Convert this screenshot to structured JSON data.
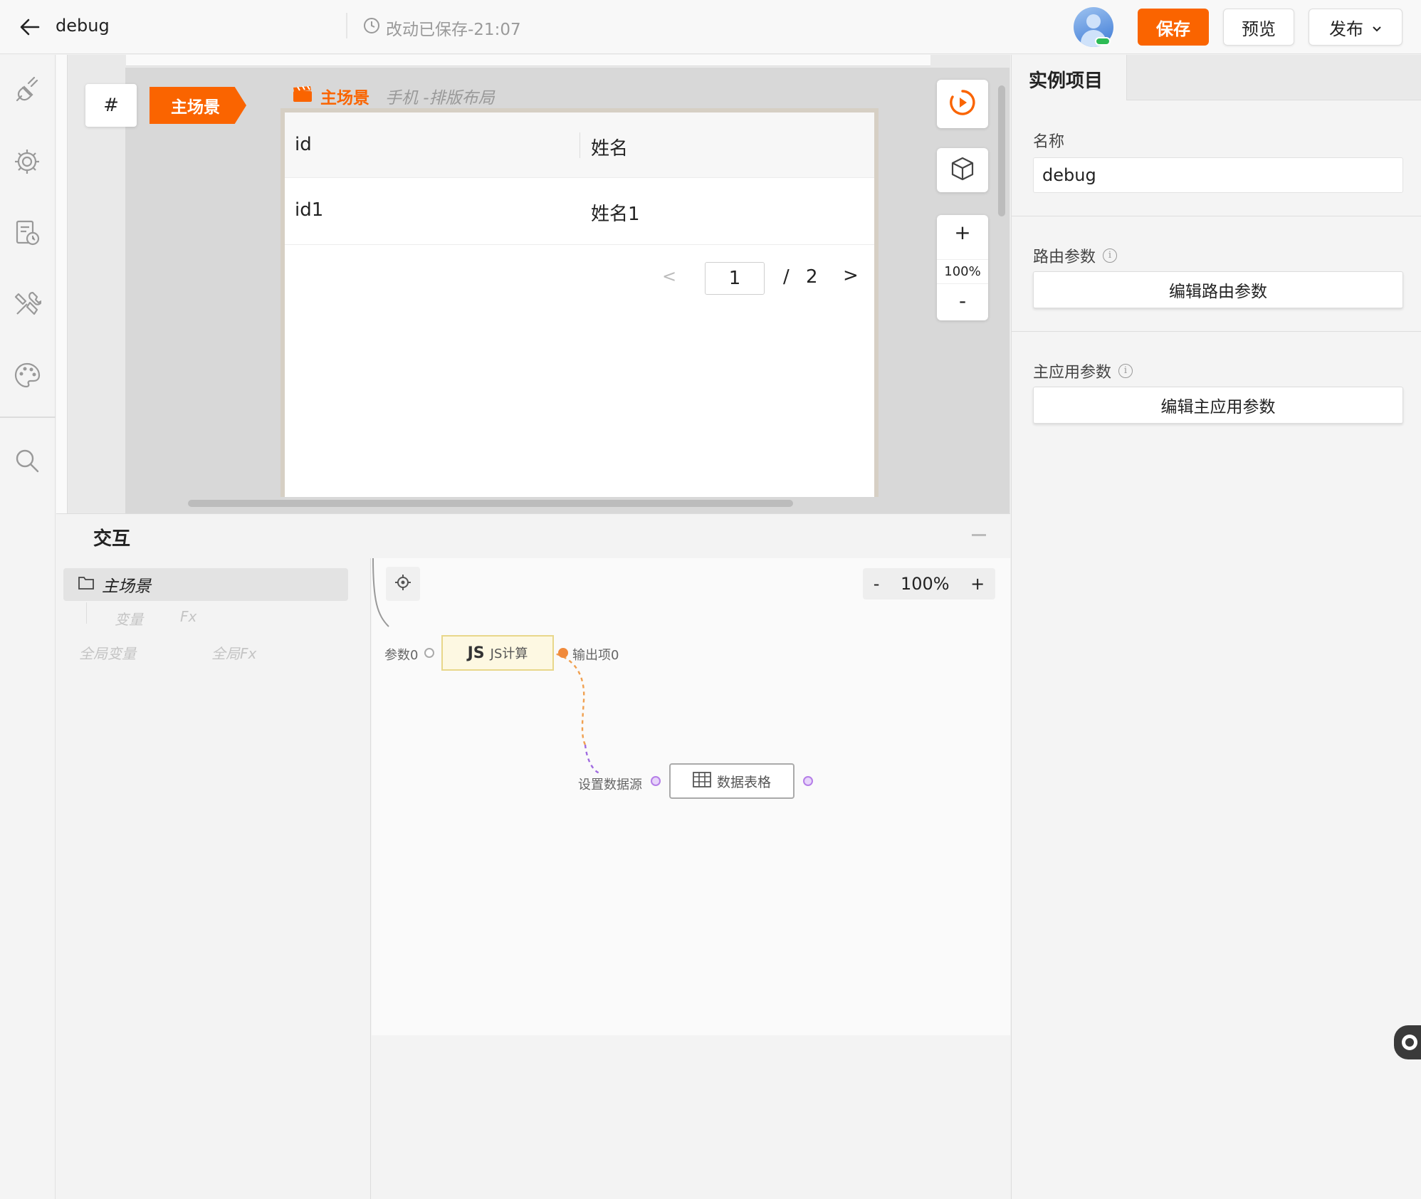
{
  "header": {
    "project_name": "debug",
    "save_status": "改动已保存-21:07",
    "save_label": "保存",
    "preview_label": "预览",
    "publish_label": "发布"
  },
  "rail": {
    "icons": [
      "plugin-icon",
      "settings-icon",
      "history-icon",
      "tools-icon",
      "palette-icon",
      "search-icon"
    ]
  },
  "canvas": {
    "hash_label": "#",
    "scene_tag": "主场景",
    "page_scene": "主场景",
    "page_layout": "手机 -排版布局",
    "table": {
      "columns": [
        "id",
        "姓名"
      ],
      "rows": [
        [
          "id1",
          "姓名1"
        ]
      ]
    },
    "pager": {
      "current": "1",
      "slash": "/",
      "total": "2",
      "prev": "<",
      "next": ">"
    },
    "zoom": {
      "plus": "+",
      "value": "100%",
      "minus": "-"
    }
  },
  "interaction": {
    "title": "交互",
    "tree": {
      "scene": "主场景",
      "var": "变量",
      "fx": "Fx",
      "global_var": "全局变量",
      "global_fx": "全局Fx"
    },
    "graph_zoom": {
      "minus": "-",
      "value": "100%",
      "plus": "+"
    },
    "nodes": {
      "js_logo": "JS",
      "js_label": "JS计算",
      "js_input": "参数0",
      "js_output": "输出项0",
      "table_label": "数据表格",
      "table_input": "设置数据源"
    },
    "colors": {
      "output_port": "#f08a3c",
      "purple_port": "#b57ee8",
      "orange_wire": "#f0a050",
      "purple_wire": "#a06be0"
    }
  },
  "props": {
    "tab": "实例项目",
    "name_label": "名称",
    "name_value": "debug",
    "route_label": "路由参数",
    "route_button": "编辑路由参数",
    "app_label": "主应用参数",
    "app_button": "编辑主应用参数",
    "info": "i"
  },
  "theme": {
    "accent": "#fa6400"
  }
}
